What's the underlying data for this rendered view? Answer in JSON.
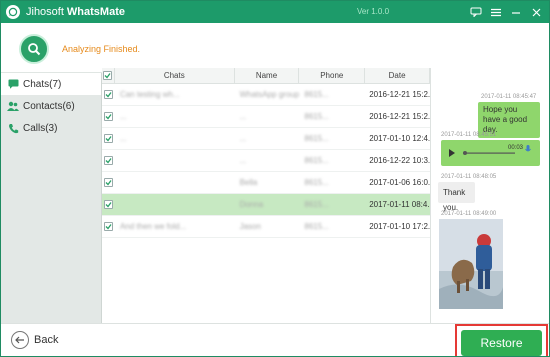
{
  "app": {
    "vendor": "Jihosoft",
    "product": "WhatsMate",
    "version": "Ver 1.0.0"
  },
  "status": {
    "text": "Analyzing Finished."
  },
  "sidebar": {
    "items": [
      {
        "label": "Chats(7)",
        "icon": "chat-icon",
        "active": true
      },
      {
        "label": "Contacts(6)",
        "icon": "contacts-icon",
        "active": false
      },
      {
        "label": "Calls(3)",
        "icon": "phone-icon",
        "active": false
      }
    ]
  },
  "table": {
    "headers": [
      "Chats",
      "Name",
      "Phone",
      "Date"
    ],
    "rows": [
      {
        "chat": "Can testing wh...",
        "name": "WhatsApp group",
        "phone": "8615...",
        "date": "2016-12-21 15:2..."
      },
      {
        "chat": "...",
        "name": "...",
        "phone": "8615...",
        "date": "2016-12-21 15:2..."
      },
      {
        "chat": "...",
        "name": "...",
        "phone": "8615...",
        "date": "2017-01-10 12:4..."
      },
      {
        "chat": "",
        "name": "...",
        "phone": "8615...",
        "date": "2016-12-22 10:3..."
      },
      {
        "chat": "",
        "name": "Bella",
        "phone": "8615...",
        "date": "2017-01-06 16:0..."
      },
      {
        "chat": "",
        "name": "Donna",
        "phone": "8615...",
        "date": "2017-01-11 08:4...",
        "selected": true
      },
      {
        "chat": "And then we fold...",
        "name": "Jason",
        "phone": "8615...",
        "date": "2017-01-10 17:2..."
      }
    ]
  },
  "chat_panel": {
    "messages": [
      {
        "time": "2017-01-11 08:45:47",
        "text": "Hope you have a good day.",
        "dir": "out"
      },
      {
        "time": "2017-01-11 08:45:51",
        "text": "00:03",
        "dir": "out",
        "kind": "audio"
      },
      {
        "time": "2017-01-11 08:48:05",
        "text": "Thank you.",
        "dir": "in"
      },
      {
        "time": "2017-01-11 08:49:00",
        "text": "",
        "dir": "in",
        "kind": "photo"
      }
    ]
  },
  "buttons": {
    "back": "Back",
    "restore": "Restore"
  },
  "colors": {
    "brand": "#1d9b6a",
    "accent_orange": "#e68a1b",
    "restore": "#2fae53",
    "highlight_frame": "#e53935",
    "selected_row": "#c7e9c2"
  }
}
